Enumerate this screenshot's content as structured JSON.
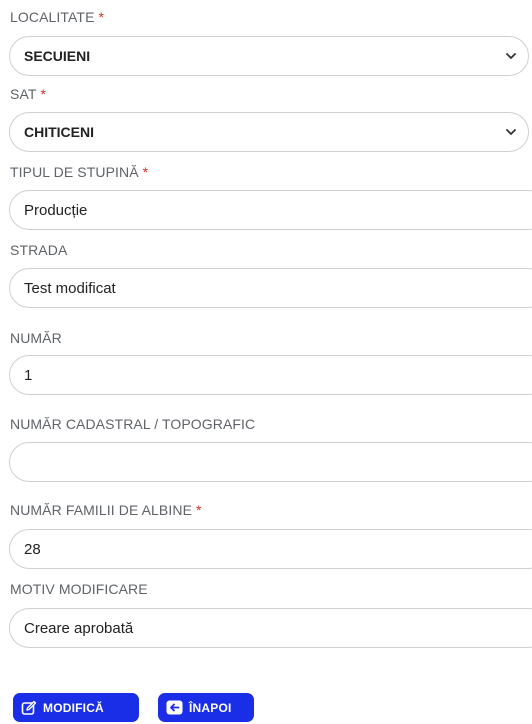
{
  "form": {
    "localitate": {
      "label": "LOCALITATE",
      "required_mark": "*",
      "value": "SECUIENI",
      "icon": "chevron-down-icon"
    },
    "sat": {
      "label": "SAT",
      "required_mark": "*",
      "value": "CHITICENI",
      "icon": "chevron-down-icon"
    },
    "tipul_stupina": {
      "label": "TIPUL DE STUPINĂ",
      "required_mark": "*",
      "value": "Producție"
    },
    "strada": {
      "label": "STRADA",
      "value": "Test modificat"
    },
    "numar": {
      "label": "NUMĂR",
      "value": "1"
    },
    "numar_cadastral": {
      "label": "NUMĂR CADASTRAL / TOPOGRAFIC",
      "value": ""
    },
    "numar_familii": {
      "label": "NUMĂR FAMILII DE ALBINE",
      "required_mark": "*",
      "value": "28"
    },
    "motiv_modificare": {
      "label": "MOTIV MODIFICARE",
      "value": "Creare aprobată"
    }
  },
  "actions": {
    "modify_label": "MODIFICĂ",
    "modify_icon": "edit-icon",
    "back_label": "ÎNAPOI",
    "back_icon": "arrow-left-icon"
  },
  "colors": {
    "primary": "#1a2ee8",
    "required": "#d93025",
    "label": "#5f6368",
    "border": "#d0d0d0"
  }
}
